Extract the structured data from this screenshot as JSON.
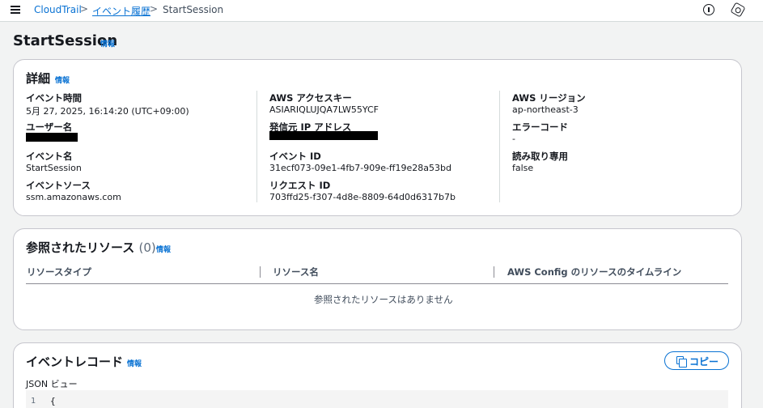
{
  "breadcrumb": {
    "root": "CloudTrail",
    "parent": "イベント履歴",
    "current": "StartSession"
  },
  "icons": {
    "menu": "hamburger-menu-icon",
    "info": "info-circle-icon",
    "settings": "hexagon-settings-icon",
    "copy": "copy-icon"
  },
  "page": {
    "title": "StartSession",
    "info": "情報"
  },
  "details": {
    "heading": "詳細",
    "info": "情報",
    "col1": [
      {
        "label": "イベント時間",
        "value": "5月 27, 2025, 16:14:20 (UTC+09:00)"
      },
      {
        "label": "ユーザー名",
        "value": ""
      },
      {
        "label": "イベント名",
        "value": "StartSession"
      },
      {
        "label": "イベントソース",
        "value": "ssm.amazonaws.com"
      }
    ],
    "col2": [
      {
        "label": "AWS アクセスキー",
        "value": "ASIARIQLUJQA7LW55YCF"
      },
      {
        "label": "発信元 IP アドレス",
        "value": ""
      },
      {
        "label": "イベント ID",
        "value": "31ecf073-09e1-4fb7-909e-ff19e28a53bd"
      },
      {
        "label": "リクエスト ID",
        "value": "703ffd25-f307-4d8e-8809-64d0d6317b7b"
      }
    ],
    "col3": [
      {
        "label": "AWS リージョン",
        "value": "ap-northeast-3"
      },
      {
        "label": "エラーコード",
        "value": "-"
      },
      {
        "label": "読み取り専用",
        "value": "false"
      }
    ]
  },
  "resources": {
    "heading": "参照されたリソース",
    "count": "(0)",
    "info": "情報",
    "columns": [
      "リソースタイプ",
      "リソース名",
      "AWS Config のリソースのタイムライン"
    ],
    "empty": "参照されたリソースはありません"
  },
  "record": {
    "heading": "イベントレコード",
    "info": "情報",
    "copy_label": "コピー",
    "json_label": "JSON ビュー",
    "line_number": "1",
    "first_line": "{"
  },
  "colors": {
    "accent": "#0972d3",
    "background": "#f2f3f3",
    "text": "#16191f"
  }
}
